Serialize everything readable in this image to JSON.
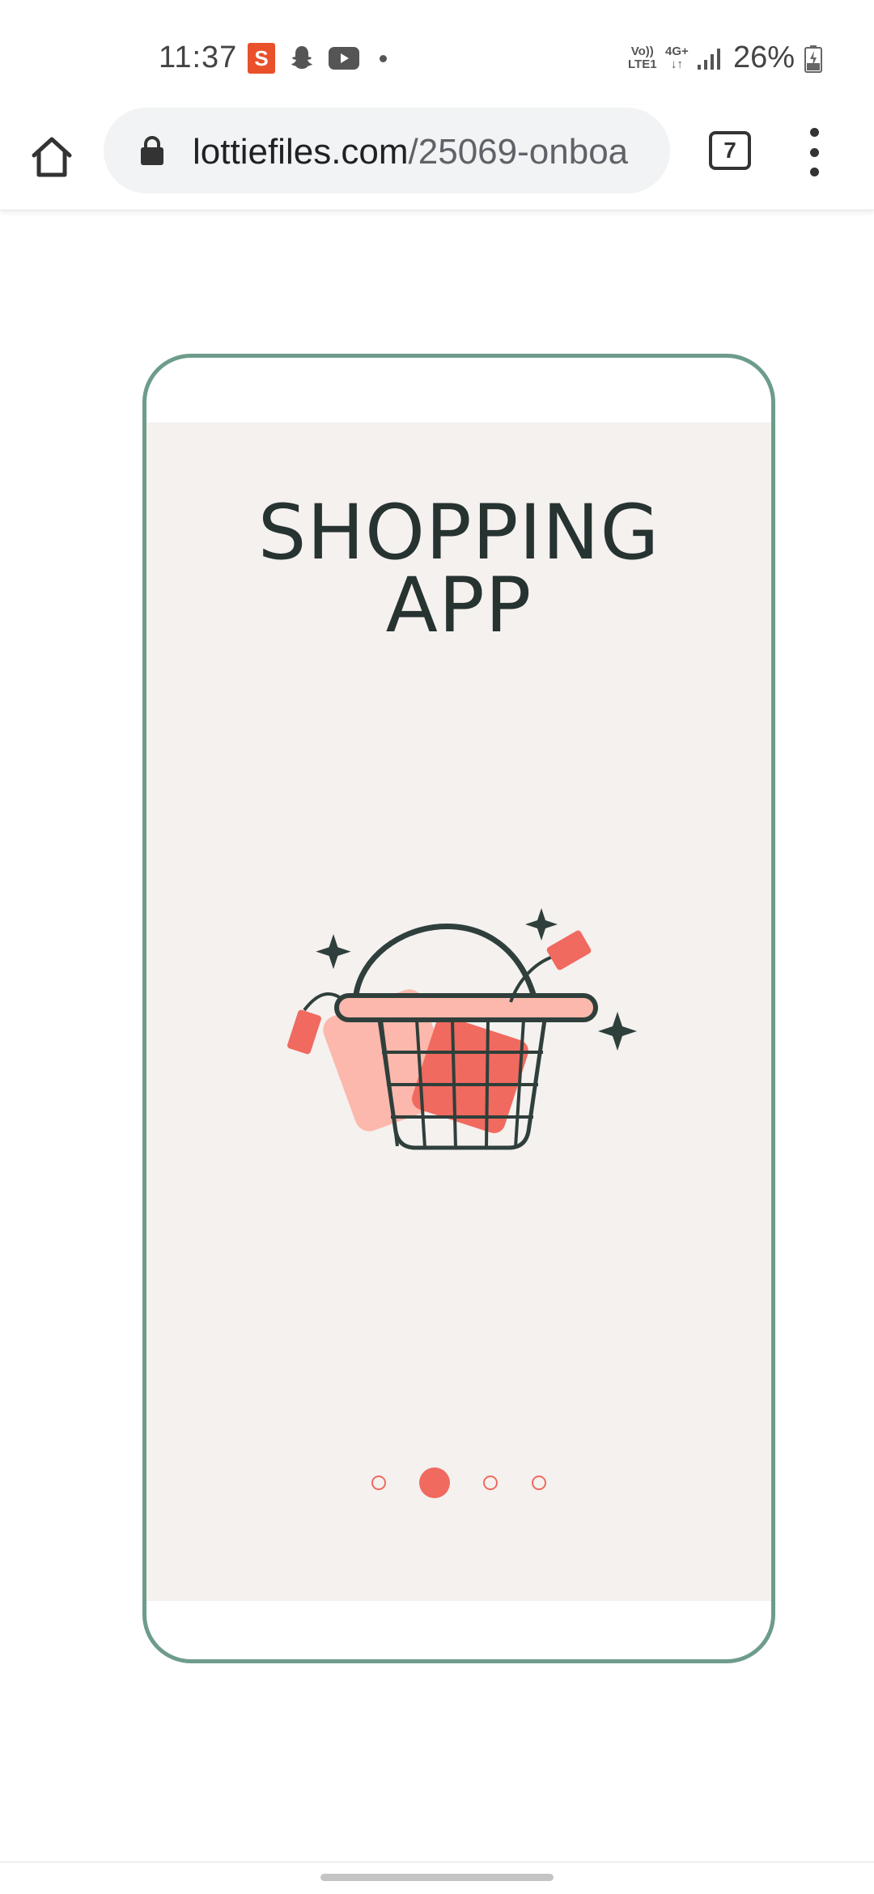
{
  "status_bar": {
    "time": "11:37",
    "sony_label": "S",
    "volte_line1": "Vo))",
    "volte_line2": "LTE1",
    "network": "4G+",
    "battery": "26%",
    "icons": [
      "sony-liv-icon",
      "snapchat-icon",
      "youtube-icon",
      "signal-icon",
      "battery-charging-icon"
    ]
  },
  "browser": {
    "url_domain": "lottiefiles.com",
    "url_path": "/25069-onboa",
    "tab_count": "7",
    "icons": [
      "home-icon",
      "lock-icon",
      "more-vert-icon"
    ]
  },
  "onboarding": {
    "title_line1": "SHOPPING",
    "title_line2": "APP",
    "page_count": 4,
    "active_page": 2
  },
  "colors": {
    "frame": "#6d9c8a",
    "screen_bg": "#f4f1ef",
    "title": "#263331",
    "accent": "#f06a5f",
    "basket": "#2f3f3b",
    "pink_light": "#fcb8ac"
  }
}
